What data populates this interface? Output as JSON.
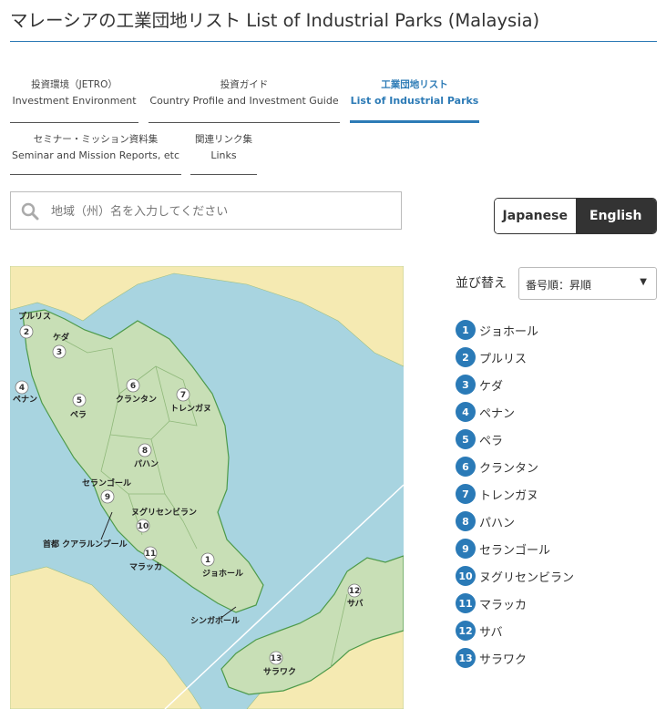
{
  "page_title": "マレーシアの工業団地リスト List of Industrial Parks (Malaysia)",
  "nav": {
    "tabs": [
      {
        "jp": "投資環境（JETRO）",
        "en": "Investment Environment"
      },
      {
        "jp": "投資ガイド",
        "en": "Country Profile and Investment Guide"
      },
      {
        "jp": "工業団地リスト",
        "en": "List of Industrial Parks"
      },
      {
        "jp": "セミナー・ミッション資料集",
        "en": "Seminar and Mission Reports, etc"
      },
      {
        "jp": "関連リンク集",
        "en": "Links"
      }
    ]
  },
  "search": {
    "placeholder": "地域（州）名を入力してください"
  },
  "language": {
    "japanese": "Japanese",
    "english": "English",
    "selected": "English"
  },
  "sort": {
    "label": "並び替え",
    "selected": "番号順：昇順"
  },
  "regions": [
    {
      "num": "1",
      "name": "ジョホール"
    },
    {
      "num": "2",
      "name": "プルリス"
    },
    {
      "num": "3",
      "name": "ケダ"
    },
    {
      "num": "4",
      "name": "ペナン"
    },
    {
      "num": "5",
      "name": "ペラ"
    },
    {
      "num": "6",
      "name": "クランタン"
    },
    {
      "num": "7",
      "name": "トレンガヌ"
    },
    {
      "num": "8",
      "name": "パハン"
    },
    {
      "num": "9",
      "name": "セランゴール"
    },
    {
      "num": "10",
      "name": "ヌグリセンビラン"
    },
    {
      "num": "11",
      "name": "マラッカ"
    },
    {
      "num": "12",
      "name": "サバ"
    },
    {
      "num": "13",
      "name": "サラワク"
    }
  ],
  "map_labels": {
    "capital": "首都 クアラルンプール",
    "singapore": "シンガポール"
  },
  "colors": {
    "accent": "#2d7bb6",
    "land": "#c8dfb6",
    "sea": "#a8d4e0",
    "other_land": "#f5eab2"
  },
  "icons": {
    "search": "search-icon",
    "dropdown": "triangle-down-icon"
  }
}
